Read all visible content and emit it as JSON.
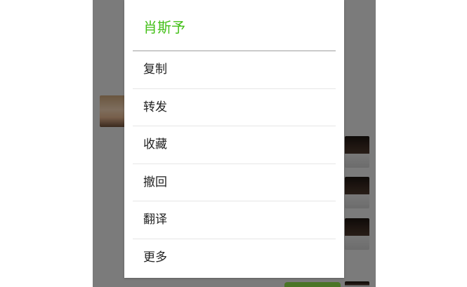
{
  "dialog": {
    "title": "肖斯予",
    "menu": [
      {
        "label": "复制"
      },
      {
        "label": "转发"
      },
      {
        "label": "收藏"
      },
      {
        "label": "撤回"
      },
      {
        "label": "翻译"
      },
      {
        "label": "更多"
      }
    ]
  },
  "colors": {
    "accent_green": "#45c01a",
    "overlay": "rgba(0,0,0,0.48)",
    "bubble_green": "#b7f08e"
  }
}
